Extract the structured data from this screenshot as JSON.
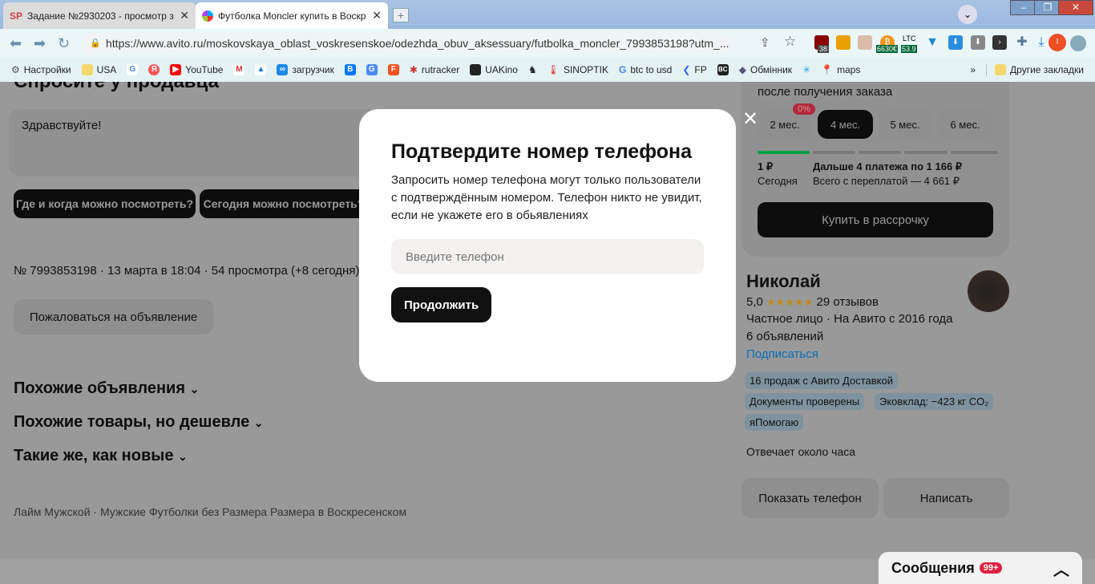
{
  "browser": {
    "tabs": [
      {
        "label": "Задание №2930203 - просмотр з",
        "icon": "SP"
      },
      {
        "label": "Футболка Moncler купить в Воскр",
        "icon": "avito-logo"
      }
    ],
    "url": "https://www.avito.ru/moskovskaya_oblast_voskresenskoe/odezhda_obuv_aksessuary/futbolka_moncler_7993853198?utm_...",
    "ext_badges": {
      "ublock": "38",
      "btc": "6630€",
      "ltc_label": "LTC",
      "ltc": "53.9",
      "profile": "I"
    },
    "bookmarks": [
      "Настройки",
      "USA",
      "",
      "",
      "YouTube",
      "",
      "",
      "загрузчик",
      "",
      "",
      "",
      "rutracker",
      "UAKino",
      "",
      "SINOPTIK",
      "btc to usd",
      "FP",
      "",
      "Обмінник",
      "",
      "maps"
    ],
    "more": "»",
    "other_bookmarks": "Другие закладки"
  },
  "page": {
    "ask_title": "Спросите у продавца",
    "message": "Здравствуйте!",
    "quick_questions": [
      "Где и когда можно посмотреть?",
      "Сегодня можно посмотреть?"
    ],
    "meta": "№ 7993853198 · 13 марта в 18:04 · 54 просмотра (+8 сегодня)",
    "report": "Пожаловаться на объявление",
    "sections": [
      "Похожие объявления",
      "Похожие товары, но дешевле",
      "Такие же, как новые"
    ],
    "breadcrumb": "Лайм Мужской · Мужские Футболки без Размера Размера в Воскресенском"
  },
  "installment": {
    "caption": "после получения заказа",
    "zero_badge": "0%",
    "months": [
      "2 мес.",
      "4 мес.",
      "5 мес.",
      "6 мес."
    ],
    "selected": "4 мес.",
    "today_amount": "1 ₽",
    "today_label": "Сегодня",
    "next": "Дальше 4 платежа по 1 166 ₽",
    "total": "Всего с переплатой — 4 661 ₽",
    "buy": "Купить в рассрочку",
    "paid_segments": 1,
    "total_segments": 5
  },
  "seller": {
    "name": "Николай",
    "rating": "5,0",
    "stars": "★★★★★",
    "reviews": "29 отзывов",
    "type": "Частное лицо · На Авито с 2016 года",
    "ads": "6 объявлений",
    "subscribe": "Подписаться",
    "chips": [
      "16 продаж с Авито Доставкой",
      "Документы проверены",
      "Эковклад: −423 кг CO₂",
      "яПомогаю"
    ],
    "response": "Отвечает около часа",
    "show_phone": "Показать телефон",
    "write": "Написать"
  },
  "modal": {
    "title": "Подтвердите номер телефона",
    "text": "Запросить номер телефона могут только пользователи с подтверждённым номером. Телефон никто не увидит, если не укажете его в обьявлениях",
    "placeholder": "Введите телефон",
    "continue": "Продолжить"
  },
  "messages": {
    "label": "Сообщения",
    "count": "99+"
  },
  "colors": {
    "accent_green": "#00a046",
    "link": "#0a6fb8",
    "badge_red": "#e0213f",
    "star": "#c08a1a"
  }
}
